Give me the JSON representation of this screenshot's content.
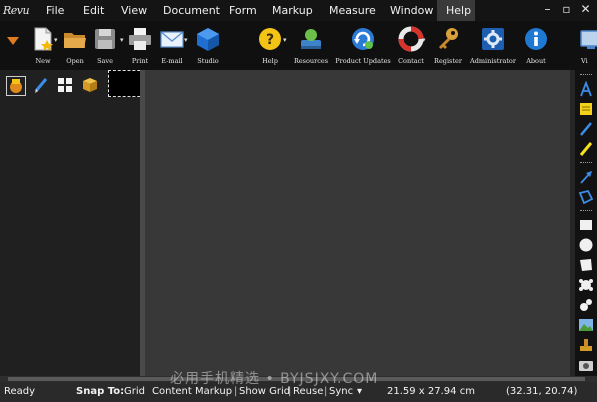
{
  "app": {
    "logo_text": "Revu"
  },
  "menu": {
    "items": [
      "File",
      "Edit",
      "View",
      "Document",
      "Form",
      "Markup",
      "Measure",
      "Window",
      "Help"
    ],
    "active": "Help"
  },
  "window_controls": {
    "minimize": "–",
    "restore": "▫",
    "close": "✕"
  },
  "toolbar": {
    "buttons": [
      {
        "label": "New",
        "icon": "new-document-icon"
      },
      {
        "label": "Open",
        "icon": "open-folder-icon"
      },
      {
        "label": "Save",
        "icon": "save-disk-icon"
      },
      {
        "label": "Print",
        "icon": "printer-icon"
      },
      {
        "label": "E-mail",
        "icon": "email-envelope-icon"
      },
      {
        "label": "Studio",
        "icon": "studio-cube-icon"
      },
      {
        "label": "Help",
        "icon": "help-question-icon"
      },
      {
        "label": "Resources",
        "icon": "resources-icon"
      },
      {
        "label": "Product Updates",
        "icon": "product-updates-icon"
      },
      {
        "label": "Contact",
        "icon": "lifebuoy-icon"
      },
      {
        "label": "Register",
        "icon": "key-icon"
      },
      {
        "label": "Administrator",
        "icon": "administrator-gear-icon"
      },
      {
        "label": "About",
        "icon": "info-icon"
      },
      {
        "label": "Vi",
        "icon": "view-icon"
      }
    ],
    "dropdown_arrow": "▾"
  },
  "left_panel": {
    "tabs": [
      "thumbnails-tab-icon",
      "markups-pen-tab-icon",
      "grid-tab-icon",
      "box-tab-icon"
    ]
  },
  "right_tools": [
    "text-tool-icon",
    "note-tool-icon",
    "pen-tool-icon",
    "highlighter-tool-icon",
    "arrow-tool-icon",
    "polygon-tool-icon",
    "rectangle-tool-icon",
    "ellipse-tool-icon",
    "cloud-tool-icon",
    "callout-tool-icon",
    "image-tool-icon",
    "stamp-tool-icon",
    "camera-tool-icon"
  ],
  "colors": {
    "menubar_bg": "#141414",
    "toolbar_bg": "#101010",
    "canvas_bg": "#383838",
    "accent_blue": "#2e7fd6",
    "accent_orange": "#e07b20"
  },
  "statusbar": {
    "ready": "Ready",
    "snap_to_label": "Snap To:",
    "snap_options": [
      "Grid",
      "Content",
      "Markup",
      "Show Grid",
      "Reuse",
      "Sync"
    ],
    "sync_arrow": "▾",
    "page_size": "21.59 x 27.94 cm",
    "cursor_coords": "(32.31, 20.74)"
  },
  "watermark": "必用手机精选 • BYJSJXY.COM"
}
